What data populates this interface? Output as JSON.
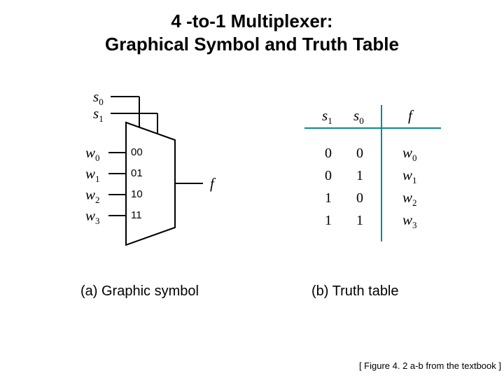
{
  "title_line1": "4 -to-1 Multiplexer:",
  "title_line2": "Graphical Symbol and Truth Table",
  "caption_a": "(a) Graphic symbol",
  "caption_b": "(b) Truth table",
  "footer": "[ Figure 4. 2 a-b from the textbook ]",
  "symbol": {
    "select": [
      "s",
      "s"
    ],
    "select_sub": [
      "0",
      "1"
    ],
    "inputs": [
      "w",
      "w",
      "w",
      "w"
    ],
    "inputs_sub": [
      "0",
      "1",
      "2",
      "3"
    ],
    "bin_labels": [
      "00",
      "01",
      "10",
      "11"
    ],
    "output": "f"
  },
  "truth_table": {
    "headers": [
      "s",
      "s",
      "f"
    ],
    "headers_sub": [
      "1",
      "0",
      ""
    ],
    "rows": [
      {
        "s1": "0",
        "s0": "0",
        "f": "w",
        "f_sub": "0"
      },
      {
        "s1": "0",
        "s0": "1",
        "f": "w",
        "f_sub": "1"
      },
      {
        "s1": "1",
        "s0": "0",
        "f": "w",
        "f_sub": "2"
      },
      {
        "s1": "1",
        "s0": "1",
        "f": "w",
        "f_sub": "3"
      }
    ]
  }
}
